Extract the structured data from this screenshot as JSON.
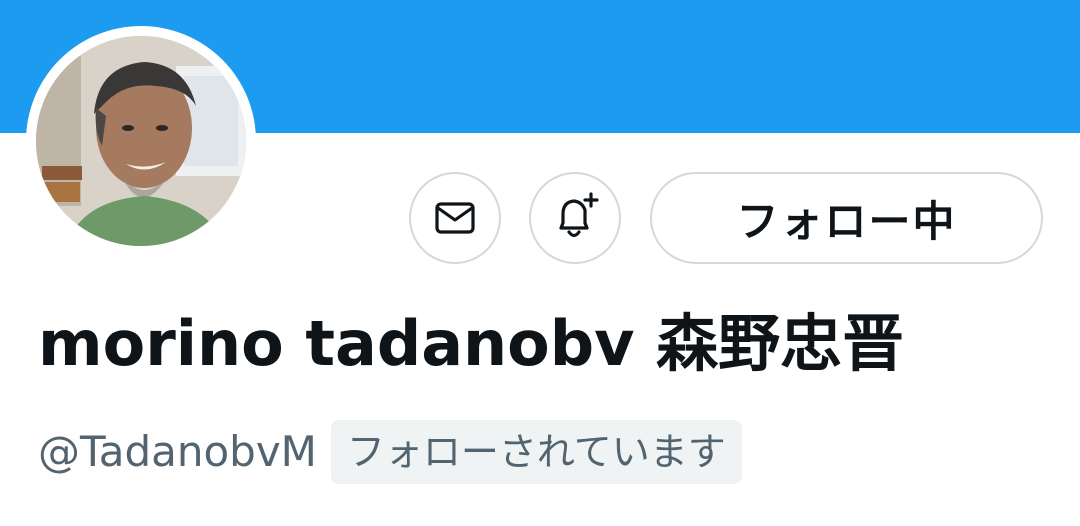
{
  "profile": {
    "display_name": "morino tadanobv 森野忠晋",
    "handle": "@TadanobvM",
    "follows_you_badge": "フォローされています",
    "follow_button_label": "フォロー中"
  },
  "icons": {
    "message": "mail-icon",
    "notifications": "bell-plus-icon"
  },
  "colors": {
    "banner": "#1d9bf0",
    "text_primary": "#0f1419",
    "text_secondary": "#536471",
    "button_border": "#cfd9de",
    "badge_background": "#eff3f4"
  }
}
